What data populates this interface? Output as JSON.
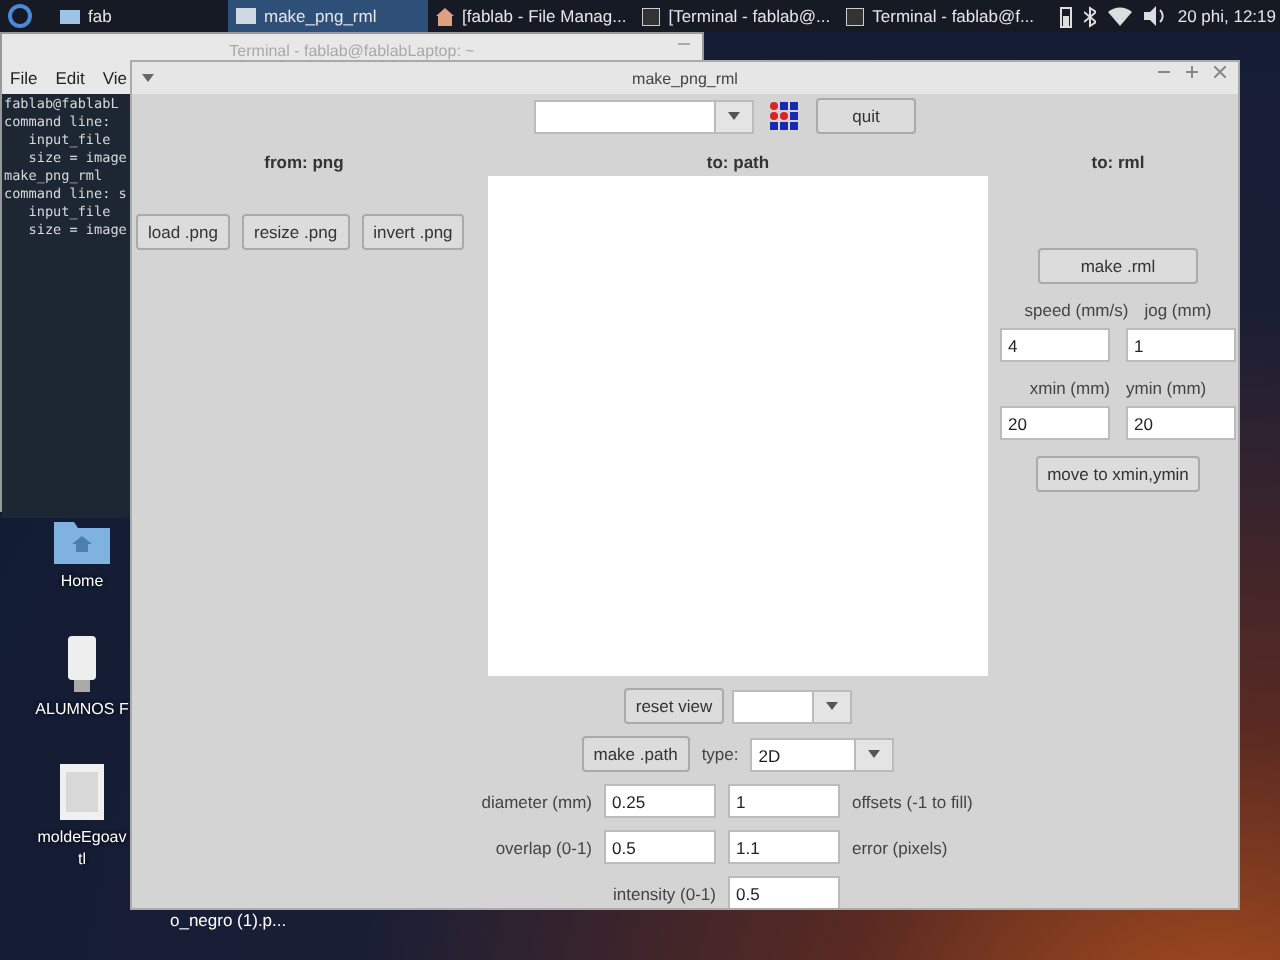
{
  "taskbar": {
    "items": [
      {
        "label": "fab",
        "kind": "folder",
        "selected": false
      },
      {
        "label": "make_png_rml",
        "kind": "window",
        "selected": true
      },
      {
        "label": "[fablab - File Manag...",
        "kind": "files",
        "selected": false
      },
      {
        "label": "[Terminal - fablab@...",
        "kind": "terminal",
        "selected": false
      },
      {
        "label": "Terminal - fablab@f...",
        "kind": "terminal",
        "selected": false
      }
    ],
    "clock": "20 phi, 12:19"
  },
  "terminal": {
    "title": "Terminal - fablab@fablabLaptop: ~",
    "menu": [
      "File",
      "Edit",
      "Vie"
    ],
    "lines": [
      "fablab@fablabL",
      "command line:",
      "   input_file",
      "   size = image",
      "make_png_rml",
      "command line: s",
      "   input_file",
      "   size = image"
    ]
  },
  "desktop_icons": [
    {
      "kind": "folder",
      "label": [
        "Home"
      ]
    },
    {
      "kind": "drive",
      "label": [
        "ALUMNOS F"
      ]
    },
    {
      "kind": "image",
      "label": [
        "moldeEgoav",
        "tl"
      ]
    }
  ],
  "desktop_stray_label": "o_negro (1).p...",
  "app": {
    "title": "make_png_rml",
    "quit": "quit",
    "from": {
      "heading": "from: png",
      "buttons": [
        "load .png",
        "resize .png",
        "invert .png"
      ]
    },
    "to_path": {
      "heading": "to: path",
      "reset": "reset view",
      "make": "make .path",
      "type_label": "type:",
      "type_value": "2D",
      "params": [
        {
          "label": "diameter (mm)",
          "value": "0.25",
          "value2": "1",
          "label2": "offsets (-1 to fill)"
        },
        {
          "label": "overlap (0-1)",
          "value": "0.5",
          "value2": "1.1",
          "label2": "error (pixels)"
        }
      ],
      "intensity": {
        "label": "intensity (0-1)",
        "value": "0.5"
      }
    },
    "to_rml": {
      "heading": "to: rml",
      "make": "make .rml",
      "fields": [
        {
          "label": "speed (mm/s)",
          "value": "4"
        },
        {
          "label": "jog (mm)",
          "value": "1"
        },
        {
          "label": "xmin (mm)",
          "value": "20"
        },
        {
          "label": "ymin (mm)",
          "value": "20"
        }
      ],
      "move": "move to xmin,ymin"
    }
  }
}
